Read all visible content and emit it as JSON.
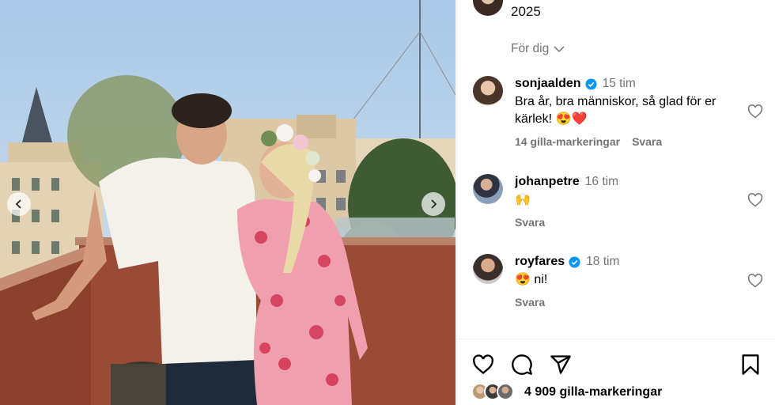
{
  "post": {
    "caption_tail": "2025",
    "carousel": {
      "prev_icon": "chevron-left-icon",
      "next_icon": "chevron-right-icon"
    }
  },
  "comments_panel": {
    "sort_label": "För dig",
    "comments": [
      {
        "username": "sonjaalden",
        "verified": true,
        "time": "15 tim",
        "text": "Bra år, bra människor, så glad för er kärlek! 😍❤️",
        "likes": "14 gilla-markeringar",
        "reply": "Svara"
      },
      {
        "username": "johanpetre",
        "verified": false,
        "time": "16 tim",
        "text": "🙌",
        "likes": "",
        "reply": "Svara"
      },
      {
        "username": "royfares",
        "verified": true,
        "time": "18 tim",
        "text": "😍 ni!",
        "likes": "",
        "reply": "Svara"
      }
    ]
  },
  "actions": {
    "like_icon": "heart-icon",
    "comment_icon": "comment-icon",
    "share_icon": "share-icon",
    "save_icon": "bookmark-icon",
    "likes_count": "4 909 gilla-markeringar"
  },
  "colors": {
    "verified": "#0095f6",
    "muted": "#737373",
    "divider": "#efefef"
  }
}
